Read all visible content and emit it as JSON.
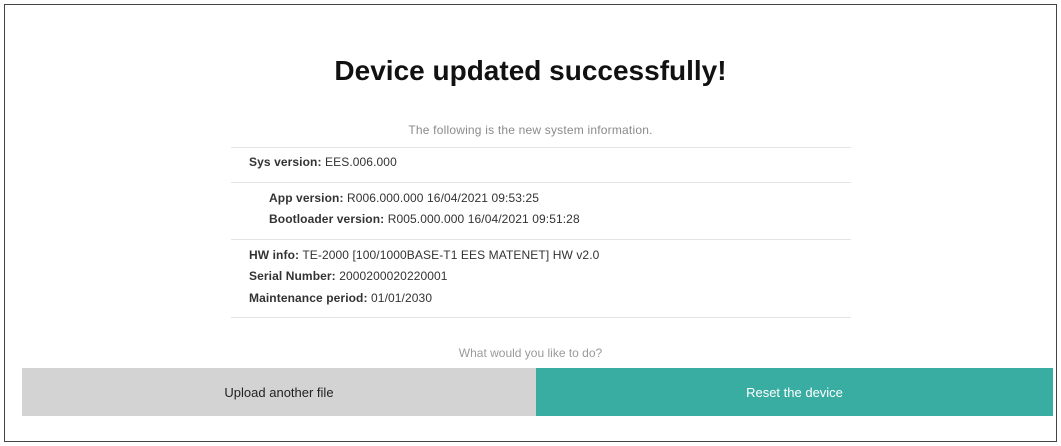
{
  "title": "Device updated successfully!",
  "subtitle": "The following is the new system information.",
  "sys": {
    "label": "Sys version:",
    "value": "EES.006.000"
  },
  "app": {
    "label": "App version:",
    "value": "R006.000.000 16/04/2021 09:53:25"
  },
  "bootloader": {
    "label": "Bootloader version:",
    "value": "R005.000.000 16/04/2021 09:51:28"
  },
  "hw": {
    "label": "HW info:",
    "value": "TE-2000 [100/1000BASE-T1 EES MATENET] HW v2.0"
  },
  "serial": {
    "label": "Serial Number:",
    "value": "2000200020220001"
  },
  "maintenance": {
    "label": "Maintenance period:",
    "value": "01/01/2030"
  },
  "prompt": "What would you like to do?",
  "actions": {
    "upload_label": "Upload another file",
    "reset_label": "Reset the device"
  },
  "colors": {
    "accent": "#3aada3",
    "secondary_button": "#d3d3d3"
  }
}
